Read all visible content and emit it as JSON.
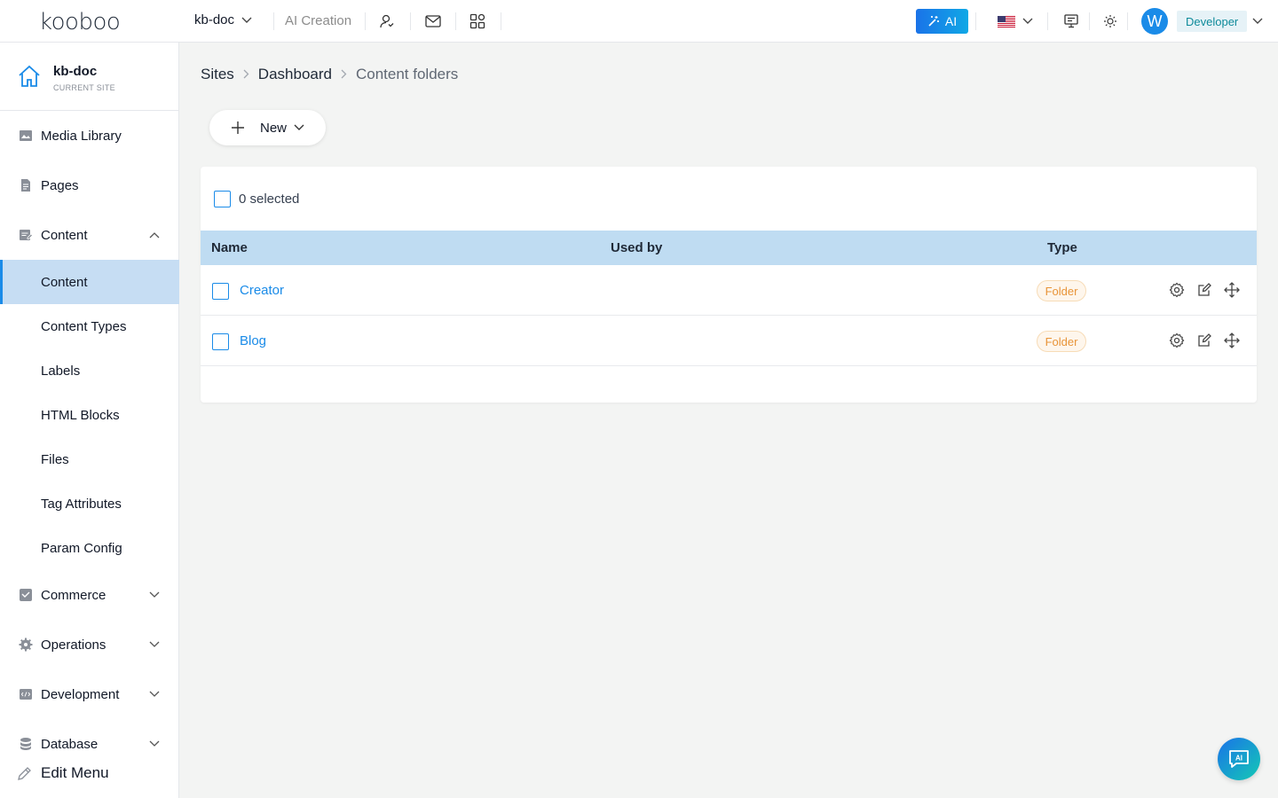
{
  "topbar": {
    "logo": "kooboo",
    "site_selector": "kb-doc",
    "ai_creation": "AI Creation",
    "ai_button": "AI",
    "avatar_letter": "W",
    "role": "Developer",
    "icons": [
      "user-settings-icon",
      "mail-icon",
      "apps-grid-icon",
      "flag-us-icon",
      "monitor-icon",
      "sun-icon"
    ]
  },
  "sidebar": {
    "site_name": "kb-doc",
    "site_sub": "CURRENT SITE",
    "items": [
      {
        "label": "Media Library",
        "icon": "image-icon"
      },
      {
        "label": "Pages",
        "icon": "page-icon"
      },
      {
        "label": "Content",
        "icon": "content-icon",
        "expanded": true
      },
      {
        "label": "Content",
        "sub": true,
        "active": true
      },
      {
        "label": "Content Types",
        "sub": true
      },
      {
        "label": "Labels",
        "sub": true
      },
      {
        "label": "HTML Blocks",
        "sub": true
      },
      {
        "label": "Files",
        "sub": true
      },
      {
        "label": "Tag Attributes",
        "sub": true
      },
      {
        "label": "Param Config",
        "sub": true
      },
      {
        "label": "Commerce",
        "icon": "commerce-icon"
      },
      {
        "label": "Operations",
        "icon": "gear-icon"
      },
      {
        "label": "Development",
        "icon": "code-icon"
      },
      {
        "label": "Database",
        "icon": "database-icon"
      }
    ],
    "edit_menu": "Edit Menu"
  },
  "breadcrumb": [
    "Sites",
    "Dashboard",
    "Content folders"
  ],
  "toolbar": {
    "new_label": "New"
  },
  "table": {
    "selected_text": "0 selected",
    "columns": [
      "Name",
      "Used by",
      "Type"
    ],
    "rows": [
      {
        "name": "Creator",
        "used_by": "",
        "type": "Folder"
      },
      {
        "name": "Blog",
        "used_by": "",
        "type": "Folder"
      }
    ]
  },
  "colors": {
    "accent": "#1a8be8",
    "header_row": "#bfdcf2",
    "badge": "#e89438"
  }
}
